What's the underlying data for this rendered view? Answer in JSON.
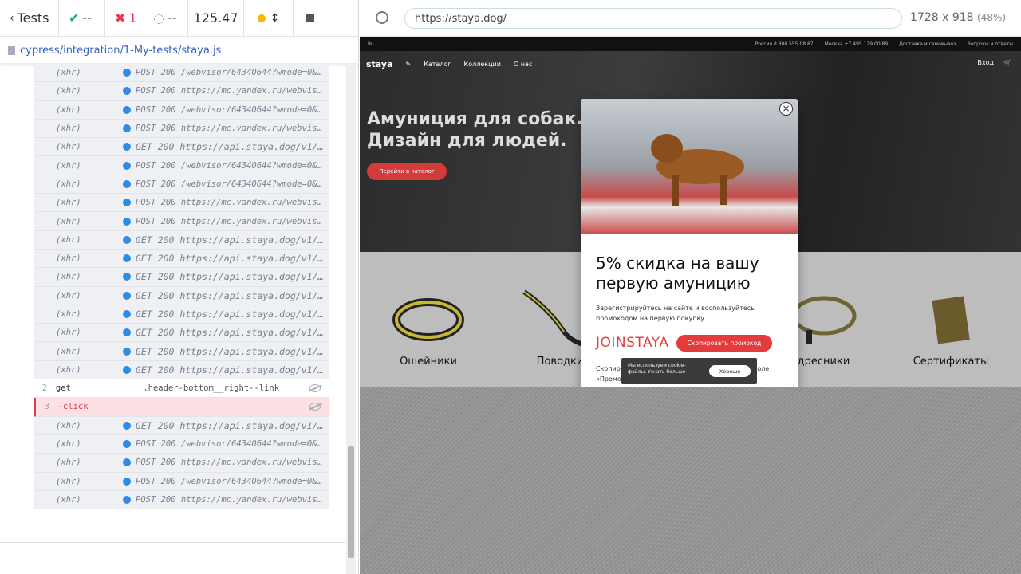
{
  "runner": {
    "tests_label": "Tests",
    "passed": "--",
    "failed": "1",
    "pending": "--",
    "duration": "125.47",
    "spec_path": "cypress/integration/1-My-tests/staya.js"
  },
  "log": [
    {
      "cmd": "(xhr)",
      "msg": "POST 200 /webvisor/64340644?wmode=0&wv-pa…",
      "kind": "xhr"
    },
    {
      "cmd": "(xhr)",
      "msg": "POST 200 https://mc.yandex.ru/webvisor/64…",
      "kind": "xhr"
    },
    {
      "cmd": "(xhr)",
      "msg": "POST 200 /webvisor/64340644?wmode=0&wv-pa…",
      "kind": "xhr"
    },
    {
      "cmd": "(xhr)",
      "msg": "POST 200 https://mc.yandex.ru/webvisor/64…",
      "kind": "xhr"
    },
    {
      "cmd": "(xhr)",
      "msg": "GET 200 https://api.staya.dog/v1/b…",
      "kind": "big"
    },
    {
      "cmd": "(xhr)",
      "msg": "POST 200 /webvisor/64340644?wmode=0&wv-pa…",
      "kind": "xhr"
    },
    {
      "cmd": "(xhr)",
      "msg": "POST 200 /webvisor/64340644?wmode=0&wv-pa…",
      "kind": "xhr"
    },
    {
      "cmd": "(xhr)",
      "msg": "POST 200 https://mc.yandex.ru/webvisor/64…",
      "kind": "xhr"
    },
    {
      "cmd": "(xhr)",
      "msg": "POST 200 https://mc.yandex.ru/webvisor/64…",
      "kind": "xhr"
    },
    {
      "cmd": "(xhr)",
      "msg": "GET 200 https://api.staya.dog/v1/b…",
      "kind": "big"
    },
    {
      "cmd": "(xhr)",
      "msg": "GET 200 https://api.staya.dog/v1/b…",
      "kind": "big"
    },
    {
      "cmd": "(xhr)",
      "msg": "GET 200 https://api.staya.dog/v1/b…",
      "kind": "big"
    },
    {
      "cmd": "(xhr)",
      "msg": "GET 200 https://api.staya.dog/v1/b…",
      "kind": "big"
    },
    {
      "cmd": "(xhr)",
      "msg": "GET 200 https://api.staya.dog/v1/b…",
      "kind": "big"
    },
    {
      "cmd": "(xhr)",
      "msg": "GET 200 https://api.staya.dog/v1/b…",
      "kind": "big"
    },
    {
      "cmd": "(xhr)",
      "msg": "GET 200 https://api.staya.dog/v1/b…",
      "kind": "big"
    },
    {
      "cmd": "(xhr)",
      "msg": "GET 200 https://api.staya.dog/v1/b…",
      "kind": "big"
    },
    {
      "n": "2",
      "cmd": "get",
      "msg": ".header-bottom__right--link",
      "kind": "get"
    },
    {
      "n": "3",
      "cmd": "-click",
      "msg": "",
      "kind": "err"
    },
    {
      "cmd": "(xhr)",
      "msg": "GET 200 https://api.staya.dog/v1/b…",
      "kind": "big"
    },
    {
      "cmd": "(xhr)",
      "msg": "POST 200 /webvisor/64340644?wmode=0&wv-pa…",
      "kind": "xhr"
    },
    {
      "cmd": "(xhr)",
      "msg": "POST 200 https://mc.yandex.ru/webvisor/64…",
      "kind": "xhr"
    },
    {
      "cmd": "(xhr)",
      "msg": "POST 200 /webvisor/64340644?wmode=0&wv-pa…",
      "kind": "xhr"
    },
    {
      "cmd": "(xhr)",
      "msg": "POST 200 https://mc.yandex.ru/webvisor/64…",
      "kind": "xhr"
    }
  ],
  "browser": {
    "url": "https://staya.dog/",
    "viewport": "1728 x 918",
    "scale": "(48%)"
  },
  "site": {
    "lang": "Ru",
    "phone_ru": "Россия 8 800 555 08 87",
    "phone_msk": "Москва +7 495 129 00 89",
    "delivery": "Доставка и самовывоз",
    "faq": "Вопросы и ответы",
    "logo": "staya",
    "nav": [
      "Каталог",
      "Коллекции",
      "О нас"
    ],
    "login": "Вход",
    "hero_title": "Амуниция для собак. Дизайн для людей.",
    "hero_button": "Перейти в каталог",
    "categories": [
      "Ошейники",
      "Поводки",
      "Адресники",
      "Сертификаты"
    ]
  },
  "modal": {
    "heading": "5% скидка на вашу первую амуницию",
    "text": "Зарегистрируйтесь на сайте и воспользуйтесь промокодом на первую покупку.",
    "promo_code": "JOINSTAYA",
    "copy_button": "Скопировать промокод",
    "note": "Скопируйте промокод JOINSTAYA и добавьте в поле «Промокод» при оформлении заказа."
  },
  "cookie": {
    "text": "Мы используем cookie-файлы. Узнать больше",
    "button": "Хорошо"
  },
  "colors": {
    "accent_red": "#e23c3c",
    "fail_red": "#e23c4e",
    "pass_green": "#1fa971",
    "link_blue": "#3a62c4"
  }
}
